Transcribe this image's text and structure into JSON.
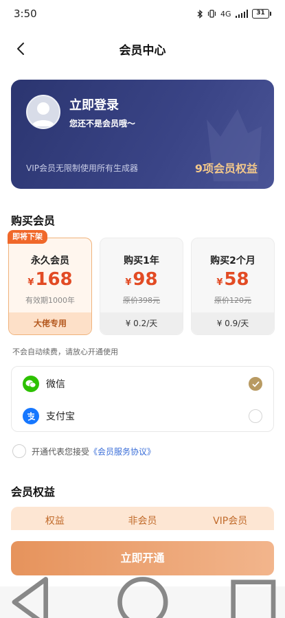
{
  "status_bar": {
    "time": "3:50",
    "network": "4G",
    "battery": "31"
  },
  "nav": {
    "title": "会员中心"
  },
  "member_card": {
    "login_label": "立即登录",
    "subtitle": "您还不是会员哦～",
    "vip_desc": "VIP会员无限制使用所有生成器",
    "rights_label": "9项会员权益"
  },
  "purchase": {
    "section_title": "购买会员",
    "plans": [
      {
        "badge": "即将下架",
        "name": "永久会员",
        "currency": "¥",
        "price": "168",
        "note": "有效期1000年",
        "footer": "大佬专用",
        "selected": true
      },
      {
        "name": "购买1年",
        "currency": "¥",
        "price": "98",
        "note": "原价398元",
        "footer": "¥ 0.2/天",
        "selected": false
      },
      {
        "name": "购买2个月",
        "currency": "¥",
        "price": "58",
        "note": "原价120元",
        "footer": "¥ 0.9/天",
        "selected": false
      }
    ],
    "auto_renew_note": "不会自动续费，请放心开通使用"
  },
  "payment": {
    "methods": [
      {
        "name": "微信",
        "icon": "wechat-icon",
        "color": "#2dc100",
        "selected": true
      },
      {
        "name": "支付宝",
        "icon": "alipay-icon",
        "color": "#1677ff",
        "selected": false
      }
    ]
  },
  "agreement": {
    "prefix": "开通代表您接受",
    "link": "《会员服务协议》"
  },
  "benefits": {
    "section_title": "会员权益",
    "columns": [
      "权益",
      "非会员",
      "VIP会员"
    ]
  },
  "cta": {
    "label": "立即开通"
  },
  "colors": {
    "card_bg": "#2b3570",
    "price_red": "#e24b24",
    "accent_orange": "#f0682a",
    "gold_check": "#b89a62",
    "cta_start": "#e6935c",
    "cta_end": "#f2b58c"
  }
}
